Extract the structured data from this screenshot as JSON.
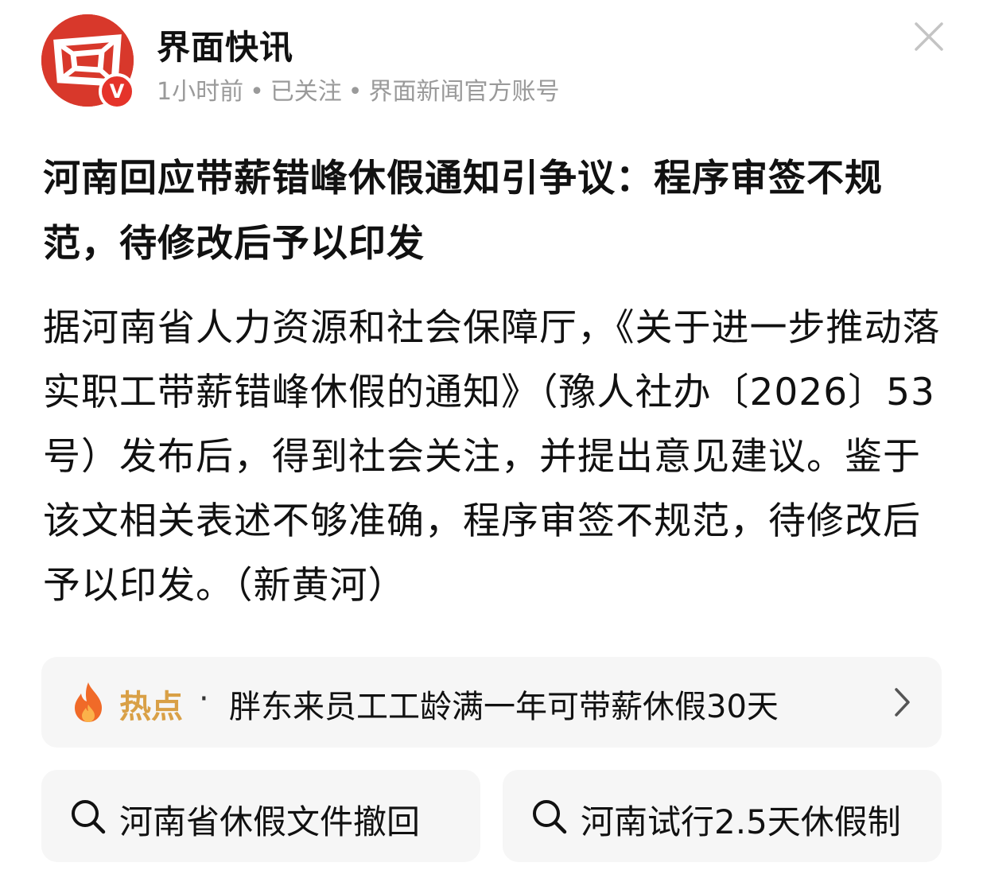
{
  "header": {
    "account_name": "界面快讯",
    "verified_badge": "V",
    "time_ago": "1小时前",
    "follow_status": "已关注",
    "account_type": "界面新闻官方账号",
    "separator": "•",
    "avatar_icon": "jiemian-logo-icon",
    "close_icon": "close-icon"
  },
  "article": {
    "title": "河南回应带薪错峰休假通知引争议：程序审签不规范，待修改后予以印发",
    "body": "据河南省人力资源和社会保障厅，《关于进一步推动落实职工带薪错峰休假的通知》（豫人社办〔2026〕53号）发布后，得到社会关注，并提出意见建议。鉴于该文相关表述不够准确，程序审签不规范，待修改后予以印发。（新黄河）"
  },
  "hot_topic": {
    "label": "热点",
    "separator": "·",
    "text": "胖东来员工工龄满一年可带薪休假30天",
    "icon": "flame-icon",
    "arrow_icon": "chevron-right-icon"
  },
  "related_searches": [
    {
      "label": "河南省休假文件撤回",
      "icon": "search-icon"
    },
    {
      "label": "河南试行2.5天休假制",
      "icon": "search-icon"
    }
  ],
  "colors": {
    "brand_red": "#d8382b",
    "hot_label": "#d9a046",
    "meta_gray": "#9a9a9a",
    "card_bg": "#f6f6f6"
  }
}
